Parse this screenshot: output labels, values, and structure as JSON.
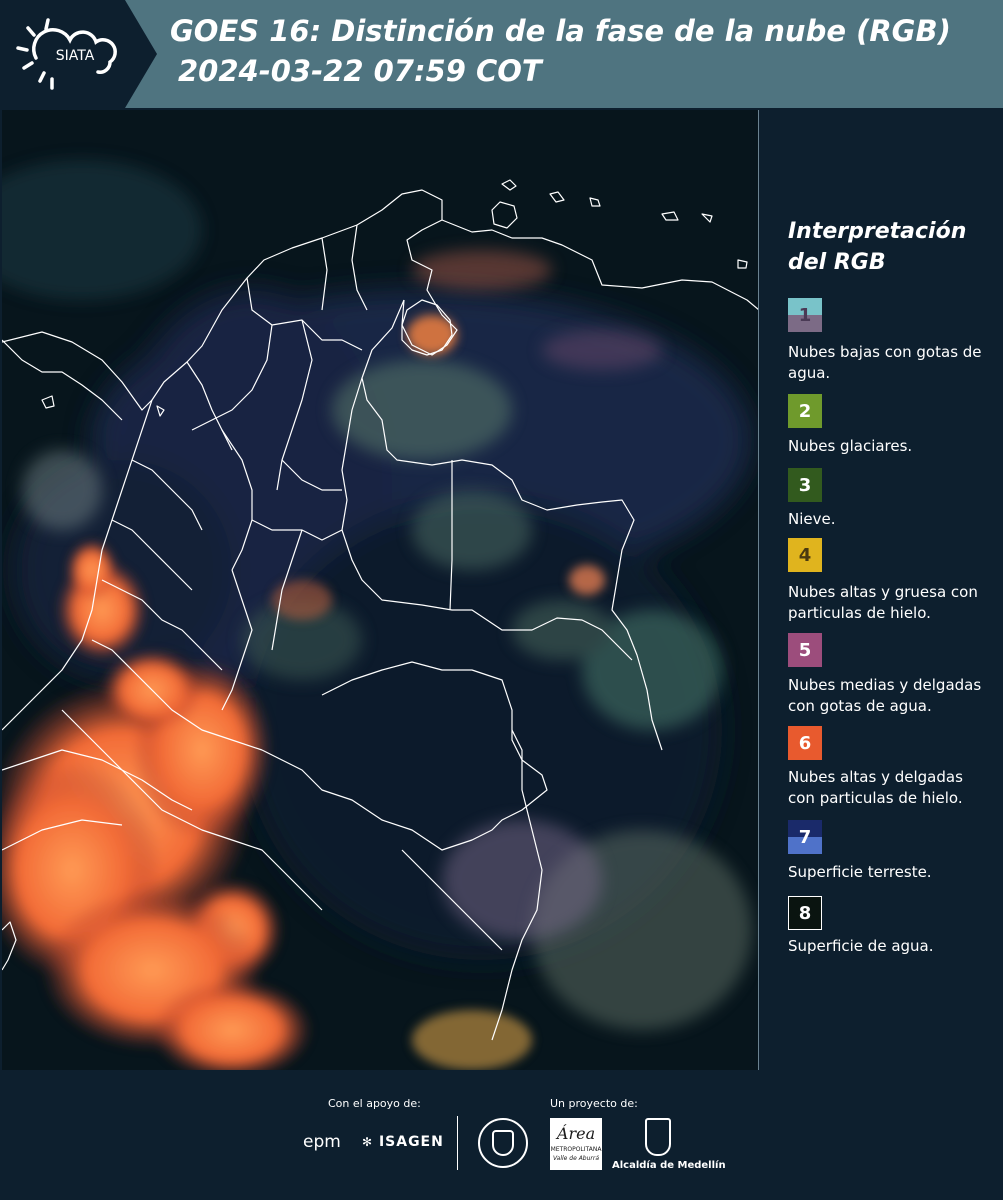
{
  "header": {
    "logo_text": "SIATA",
    "title": "GOES 16: Distinción de la fase de la nube (RGB)",
    "subtitle": "2024-03-22 07:59 COT"
  },
  "legend": {
    "title": "Interpretación del RGB",
    "items": [
      {
        "number": "1",
        "label": "Nubes bajas con gotas de agua.",
        "color_top": "#79c3c9",
        "color_bottom": "#7c6b86"
      },
      {
        "number": "2",
        "label": "Nubes glaciares.",
        "color": "#6f9a2c"
      },
      {
        "number": "3",
        "label": "Nieve.",
        "color": "#325a1e"
      },
      {
        "number": "4",
        "label": "Nubes altas y gruesa con particulas de hielo.",
        "color": "#e0b41e"
      },
      {
        "number": "5",
        "label": "Nubes medias y delgadas con gotas de agua.",
        "color": "#9c4d7c"
      },
      {
        "number": "6",
        "label": "Nubes altas y delgadas con particulas de hielo.",
        "color": "#e85a2e"
      },
      {
        "number": "7",
        "label": "Superficie terreste.",
        "color_top": "#1a2a6a",
        "color_bottom": "#4f72c9"
      },
      {
        "number": "8",
        "label": "Superficie de agua.",
        "color": "#0a1410"
      }
    ]
  },
  "footer": {
    "support_label": "Con el apoyo de:",
    "project_label": "Un proyecto de:",
    "brand_epm": "epm",
    "brand_isagen": "ISAGEN",
    "brand_area": "Área",
    "brand_area_sub1": "METROPOLITANA",
    "brand_area_sub2": "Valle de Aburrá",
    "brand_alcaldia": "Alcaldía de Medellín"
  }
}
